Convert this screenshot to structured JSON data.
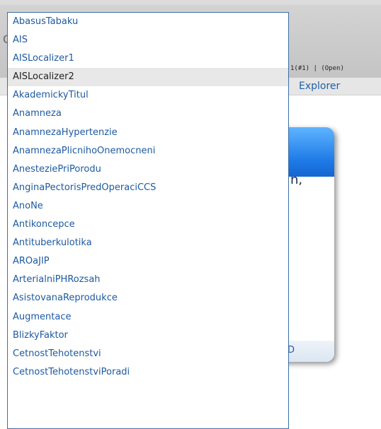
{
  "background": {
    "status_text": "1(#1) | (Open)",
    "explorer_label": "Explorer",
    "card_partial_text": "n,",
    "card_footer_letter": "D"
  },
  "dropdown": {
    "selected_index": 3,
    "items": [
      "AbasusTabaku",
      "AIS",
      "AISLocalizer1",
      "AISLocalizer2",
      "AkademickyTitul",
      "Anamneza",
      "AnamnezaHypertenzie",
      "AnamnezaPlicnihoOnemocneni",
      "AnesteziePriPorodu",
      "AnginaPectorisPredOperaciCCS",
      "AnoNe",
      "Antikoncepce",
      "Antituberkulotika",
      "AROaJIP",
      "ArterialniPHRozsah",
      "AsistovanaReprodukce",
      "Augmentace",
      "BlizkyFaktor",
      "CetnostTehotenstvi",
      "CetnostTehotenstviPoradi"
    ]
  },
  "colors": {
    "link": "#1d5aa0",
    "selected_bg": "#e8e8e8",
    "border": "#3c6ea5"
  }
}
